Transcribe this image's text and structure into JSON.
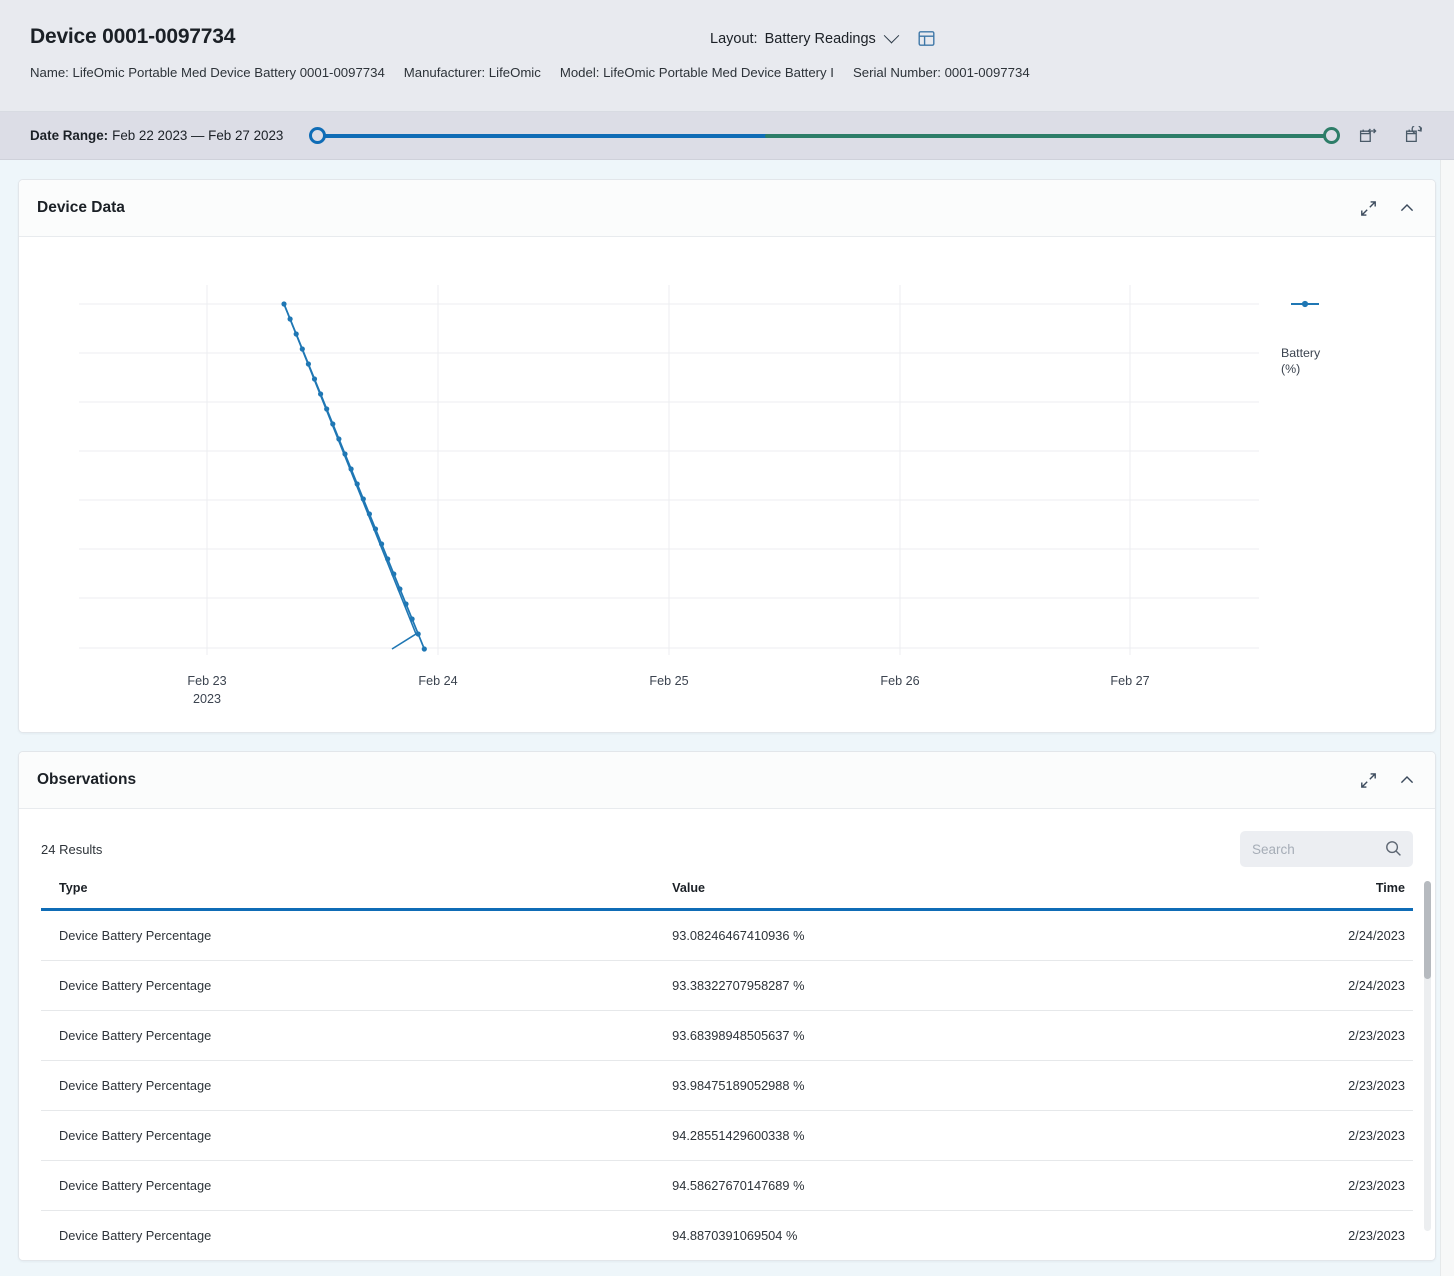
{
  "header": {
    "device_title": "Device 0001-0097734",
    "layout_label": "Layout:",
    "layout_value": "Battery Readings",
    "chevron_icon": "chevron-down-icon",
    "panel_icon": "panel-layout-icon",
    "meta": [
      "Name: LifeOmic Portable Med Device Battery 0001-0097734",
      "Manufacturer: LifeOmic",
      "Model: LifeOmic Portable Med Device Battery I",
      "Serial Number: 0001-0097734"
    ]
  },
  "date_range": {
    "label": "Date Range:",
    "value": "Feb 22 2023  —  Feb 27 2023",
    "start": "Feb 22 2023",
    "end": "Feb 27 2023",
    "handle_left_color": "#0f6cb6",
    "handle_right_color": "#2d7d68",
    "icons": [
      "calendar-shift-icon",
      "calendar-reset-icon"
    ]
  },
  "device_data_card": {
    "title": "Device Data",
    "expand_icon": "expand-icon",
    "collapse_icon": "chevron-up-icon"
  },
  "observations_card": {
    "title": "Observations",
    "expand_icon": "expand-icon",
    "collapse_icon": "chevron-up-icon",
    "results_count": "24 Results",
    "search_placeholder": "Search",
    "search_value": "",
    "search_icon": "search-icon",
    "columns": [
      "Type",
      "Value",
      "Time"
    ],
    "rows": [
      {
        "type": "Device Battery Percentage",
        "value": "93.08246467410936 %",
        "time": "2/24/2023"
      },
      {
        "type": "Device Battery Percentage",
        "value": "93.38322707958287 %",
        "time": "2/24/2023"
      },
      {
        "type": "Device Battery Percentage",
        "value": "93.68398948505637 %",
        "time": "2/23/2023"
      },
      {
        "type": "Device Battery Percentage",
        "value": "93.98475189052988 %",
        "time": "2/23/2023"
      },
      {
        "type": "Device Battery Percentage",
        "value": "94.28551429600338 %",
        "time": "2/23/2023"
      },
      {
        "type": "Device Battery Percentage",
        "value": "94.58627670147689 %",
        "time": "2/23/2023"
      },
      {
        "type": "Device Battery Percentage",
        "value": "94.8870391069504 %",
        "time": "2/23/2023"
      }
    ]
  },
  "chart_data": {
    "type": "line",
    "title": "",
    "xlabel": "",
    "ylabel": "",
    "series_color": "#1f77b4",
    "grid": true,
    "legend_position": "right",
    "legend": [
      "Battery (%)"
    ],
    "xtick_labels": [
      "Feb 23",
      "Feb 24",
      "Feb 25",
      "Feb 26",
      "Feb 27"
    ],
    "xtick_sublabel": "2023",
    "ytick_labels": [],
    "xlim": [
      "Feb 22 2023",
      "Feb 27 2023"
    ],
    "ylim": [
      93.0,
      100.0
    ],
    "series": [
      {
        "name": "Battery (%)",
        "x": [
          "2023-02-23T07:48",
          "2023-02-23T08:48",
          "2023-02-23T09:48",
          "2023-02-23T10:48",
          "2023-02-23T11:48",
          "2023-02-23T12:48",
          "2023-02-23T13:48",
          "2023-02-23T14:48",
          "2023-02-23T15:48",
          "2023-02-23T16:48",
          "2023-02-23T17:48",
          "2023-02-23T18:48",
          "2023-02-23T19:48",
          "2023-02-23T20:48",
          "2023-02-23T21:48",
          "2023-02-23T22:48",
          "2023-02-23T23:48",
          "2023-02-24T00:48",
          "2023-02-24T01:48",
          "2023-02-24T02:48",
          "2023-02-24T03:48",
          "2023-02-24T04:48",
          "2023-02-24T05:48",
          "2023-02-24T06:48"
        ],
        "y": [
          100.0,
          99.7,
          99.39,
          99.09,
          98.79,
          98.49,
          98.19,
          97.89,
          97.59,
          97.29,
          96.99,
          96.69,
          96.39,
          96.09,
          95.79,
          95.49,
          95.19,
          94.89,
          94.59,
          94.29,
          93.98,
          93.68,
          93.38,
          93.08
        ]
      }
    ]
  }
}
